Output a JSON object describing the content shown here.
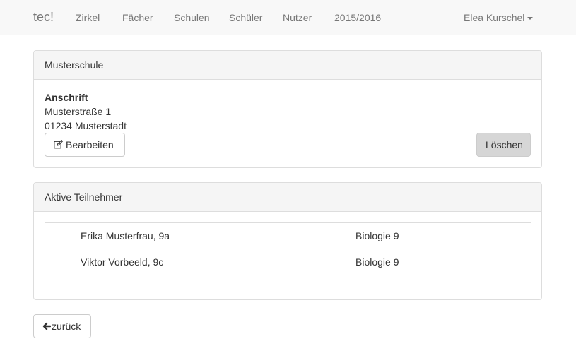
{
  "navbar": {
    "brand": "tec!",
    "items": [
      "Zirkel",
      "Fächer",
      "Schulen",
      "Schüler",
      "Nutzer",
      "2015/2016"
    ],
    "user": "Elea Kurschel"
  },
  "school_panel": {
    "title": "Musterschule",
    "address_label": "Anschrift",
    "address_line1": "Musterstraße 1",
    "address_line2": "01234 Musterstadt",
    "edit_label": "Bearbeiten",
    "edit_icon": "edit-icon",
    "delete_label": "Löschen"
  },
  "participants_panel": {
    "title": "Aktive Teilnehmer",
    "rows": [
      {
        "name": "Erika Musterfrau, 9a",
        "course": "Biologie 9"
      },
      {
        "name": "Viktor Vorbeeld, 9c",
        "course": "Biologie 9"
      }
    ]
  },
  "back_button": {
    "label": "zurück",
    "icon": "arrow-left-icon"
  }
}
